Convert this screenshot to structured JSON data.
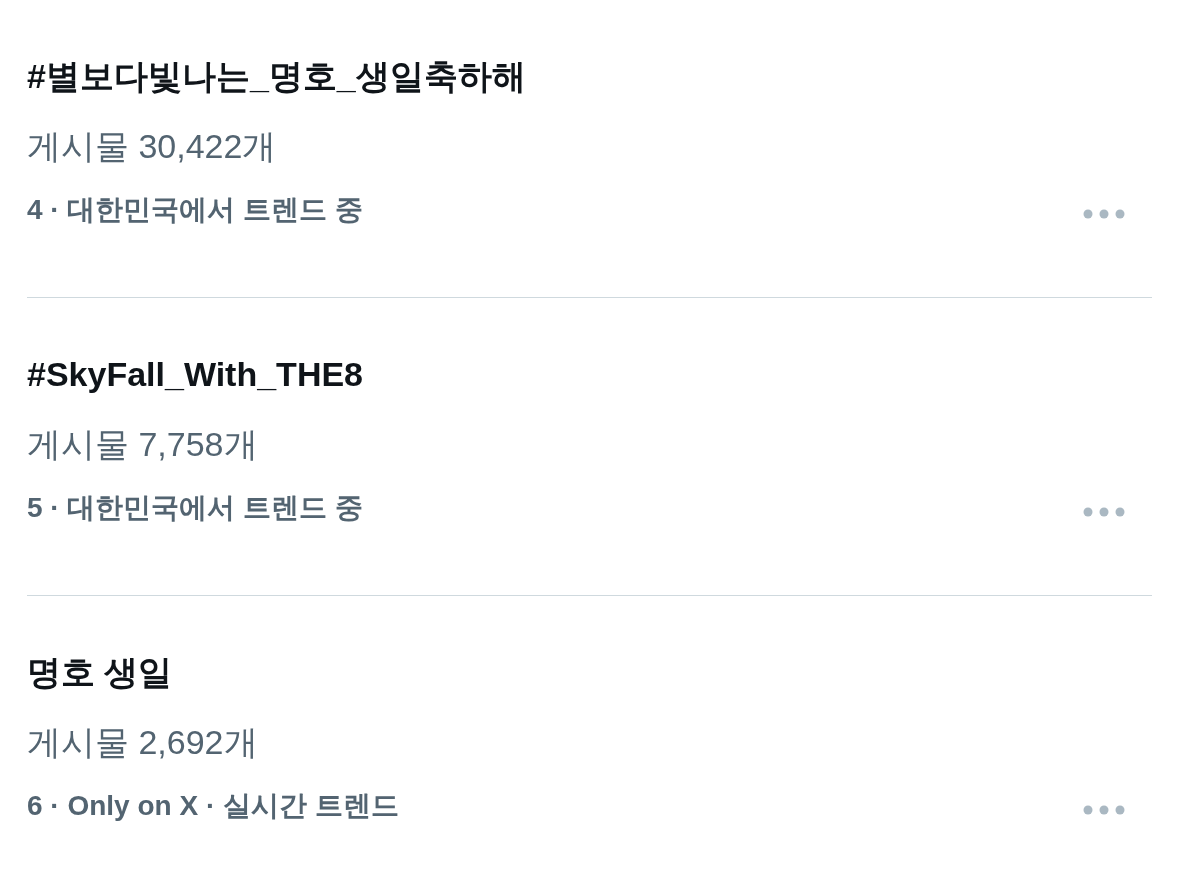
{
  "trends": [
    {
      "title": "#별보다빛나는_명호_생일축하해",
      "posts": "게시물 30,422개",
      "meta": "4 · 대한민국에서 트렌드 중"
    },
    {
      "title": "#SkyFall_With_THE8",
      "posts": "게시물 7,758개",
      "meta": "5 · 대한민국에서 트렌드 중"
    },
    {
      "title": "명호 생일",
      "posts": "게시물 2,692개",
      "meta": "6 · Only on X · 실시간 트렌드"
    }
  ]
}
